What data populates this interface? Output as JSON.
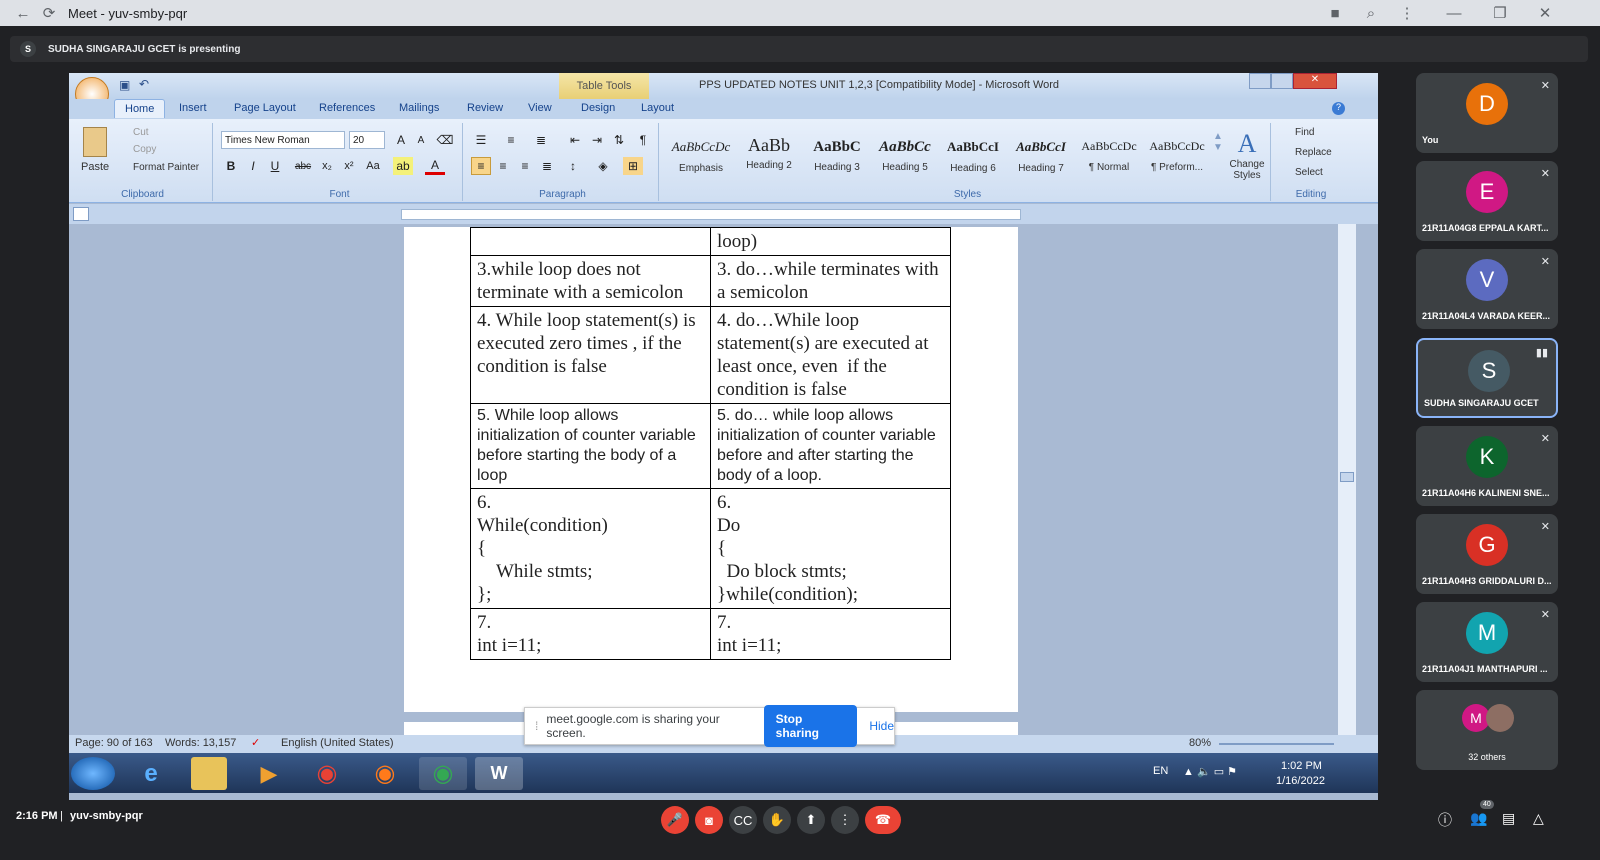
{
  "browser": {
    "title": "Meet - yuv-smby-pqr"
  },
  "presenting": {
    "initial": "S",
    "text": "SUDHA SINGARAJU GCET is presenting"
  },
  "word": {
    "contextual_tab": "Table Tools",
    "window_title": "PPS UPDATED NOTES UNIT 1,2,3 [Compatibility Mode] - Microsoft Word",
    "tabs": [
      "Home",
      "Insert",
      "Page Layout",
      "References",
      "Mailings",
      "Review",
      "View",
      "Design",
      "Layout"
    ],
    "clipboard": {
      "paste": "Paste",
      "cut": "Cut",
      "copy": "Copy",
      "format_painter": "Format Painter",
      "label": "Clipboard"
    },
    "font": {
      "name": "Times New Roman",
      "size": "20",
      "label": "Font"
    },
    "paragraph": {
      "label": "Paragraph"
    },
    "styles": {
      "items": [
        {
          "preview": "AaBbCcDc",
          "name": "Emphasis"
        },
        {
          "preview": "AaBb",
          "name": "Heading 2"
        },
        {
          "preview": "AaBbC",
          "name": "Heading 3"
        },
        {
          "preview": "AaBbCc",
          "name": "Heading 5"
        },
        {
          "preview": "AaBbCcI",
          "name": "Heading 6"
        },
        {
          "preview": "AaBbCcI",
          "name": "Heading 7"
        },
        {
          "preview": "AaBbCcDc",
          "name": "¶ Normal"
        },
        {
          "preview": "AaBbCcDc",
          "name": "¶ Preform..."
        }
      ],
      "change_styles": "Change Styles",
      "label": "Styles"
    },
    "editing": {
      "find": "Find",
      "replace": "Replace",
      "select": "Select",
      "label": "Editing"
    },
    "table": {
      "rows": [
        {
          "left": "",
          "right": "loop)",
          "font": "serif"
        },
        {
          "left": "3.while loop does not terminate with a semicolon",
          "right": "3. do…while terminates with a semicolon",
          "font": "serif"
        },
        {
          "left": "4. While loop statement(s) is executed zero times , if the condition is false",
          "right": "4. do…While loop statement(s) are executed at least once, even  if the condition is false",
          "font": "serif"
        },
        {
          "left": "5. While loop allows initialization of counter variable before starting the body of a loop",
          "right": "5. do… while loop allows initialization of counter variable before and after starting the body of a loop.",
          "font": "sans"
        },
        {
          "left": "6.\nWhile(condition)\n{\n    While stmts;\n};",
          "right": "6.\nDo\n{\n  Do block stmts;\n}while(condition);",
          "font": "serif"
        },
        {
          "left": "7.\nint i=11;",
          "right": "7.\nint i=11;",
          "font": "serif"
        }
      ]
    },
    "status": {
      "page": "Page: 90 of 163",
      "words": "Words: 13,157",
      "language": "English (United States)",
      "zoom": "80%"
    },
    "clock": {
      "time": "1:02 PM",
      "date": "1/16/2022"
    },
    "lang": "EN"
  },
  "share_bar": {
    "text": "meet.google.com is sharing your screen.",
    "stop": "Stop sharing",
    "hide": "Hide"
  },
  "participants": [
    {
      "initial": "D",
      "name": "You",
      "color": "#e8710a"
    },
    {
      "initial": "E",
      "name": "21R11A04G8 EPPALA KART...",
      "color": "#d01884"
    },
    {
      "initial": "V",
      "name": "21R11A04L4 VARADA KEER...",
      "color": "#5c6bc0"
    },
    {
      "initial": "S",
      "name": "SUDHA SINGARAJU GCET",
      "color": "#455a64"
    },
    {
      "initial": "K",
      "name": "21R11A04H6 KALINENI SNE...",
      "color": "#0d652d"
    },
    {
      "initial": "G",
      "name": "21R11A04H3 GRIDDALURI D...",
      "color": "#d93025"
    },
    {
      "initial": "M",
      "name": "21R11A04J1 MANTHAPURI ...",
      "color": "#12a4af"
    }
  ],
  "others": {
    "initial": "M",
    "text": "32 others"
  },
  "meeting": {
    "time": "2:16 PM",
    "separator": "|",
    "code": "yuv-smby-pqr",
    "people_count": "40"
  }
}
